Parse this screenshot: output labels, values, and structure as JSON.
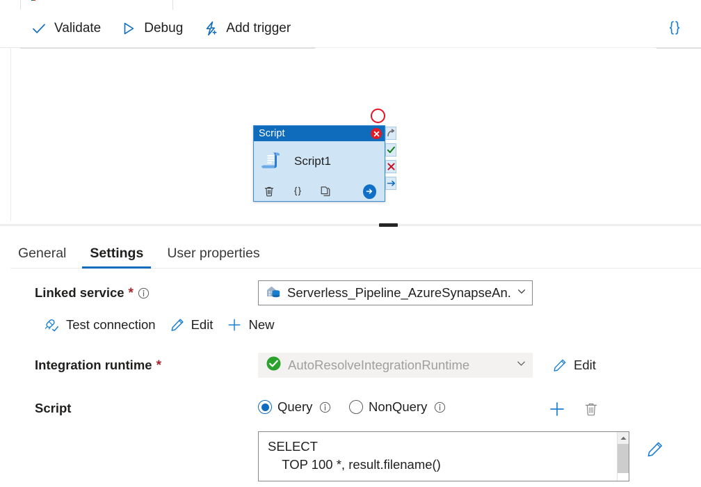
{
  "command_bar": {
    "buttons": [
      {
        "label": "Validate",
        "icon": "checkmark-icon"
      },
      {
        "label": "Debug",
        "icon": "play-triangle-icon"
      },
      {
        "label": "Add trigger",
        "icon": "lightning-plus-icon"
      }
    ],
    "code_view": {
      "label": "{}",
      "icon": "code-braces-icon"
    }
  },
  "canvas": {
    "annotation_marker": "red-circle-highlight",
    "node": {
      "header_title": "Script",
      "activity_name": "Script1",
      "close_label": "✕",
      "footer_icons": [
        "delete-icon",
        "code-braces-icon",
        "clone-icon"
      ],
      "run_icon": "arrow-right-circle-icon",
      "header_color": "#0f6cbd",
      "body_color": "#cfe5f5"
    },
    "connectors": [
      {
        "name": "skip-connector",
        "glyph": "↷",
        "color": "#6e6e6e"
      },
      {
        "name": "success-connector",
        "glyph": "✓",
        "color": "#107c10"
      },
      {
        "name": "failure-connector",
        "glyph": "✕",
        "color": "#c50f1f"
      },
      {
        "name": "completion-connector",
        "glyph": "→",
        "color": "#0f6cbd"
      }
    ]
  },
  "properties": {
    "tabs": [
      {
        "label": "General",
        "active": false
      },
      {
        "label": "Settings",
        "active": true
      },
      {
        "label": "User properties",
        "active": false
      }
    ],
    "linked_service": {
      "label": "Linked service",
      "required": "*",
      "info": "i",
      "value": "Serverless_Pipeline_AzureSynapseAn..",
      "icon": "linked-service-icon",
      "actions": [
        {
          "label": "Test connection",
          "icon": "plug-check-icon"
        },
        {
          "label": "Edit",
          "icon": "pencil-icon"
        },
        {
          "label": "New",
          "icon": "plus-icon"
        }
      ]
    },
    "integration_runtime": {
      "label": "Integration runtime",
      "required": "*",
      "value": "AutoResolveIntegrationRuntime",
      "status_icon": "green-check-icon",
      "disabled": true,
      "edit_label": "Edit",
      "edit_icon": "pencil-icon"
    },
    "script": {
      "label": "Script",
      "radios": [
        {
          "label": "Query",
          "selected": true,
          "info": "i"
        },
        {
          "label": "NonQuery",
          "selected": false,
          "info": "i"
        }
      ],
      "add_icon": "plus-icon",
      "delete_icon": "trash-icon",
      "editor_text": "SELECT\n    TOP 100 *, result.filename()",
      "expand_icon": "pencil-icon",
      "scrollbar": "vertical-scrollbar"
    }
  },
  "colors": {
    "accent": "#0f6cbd",
    "required": "#a4262c",
    "success": "#107c10",
    "error": "#c50f1f"
  }
}
